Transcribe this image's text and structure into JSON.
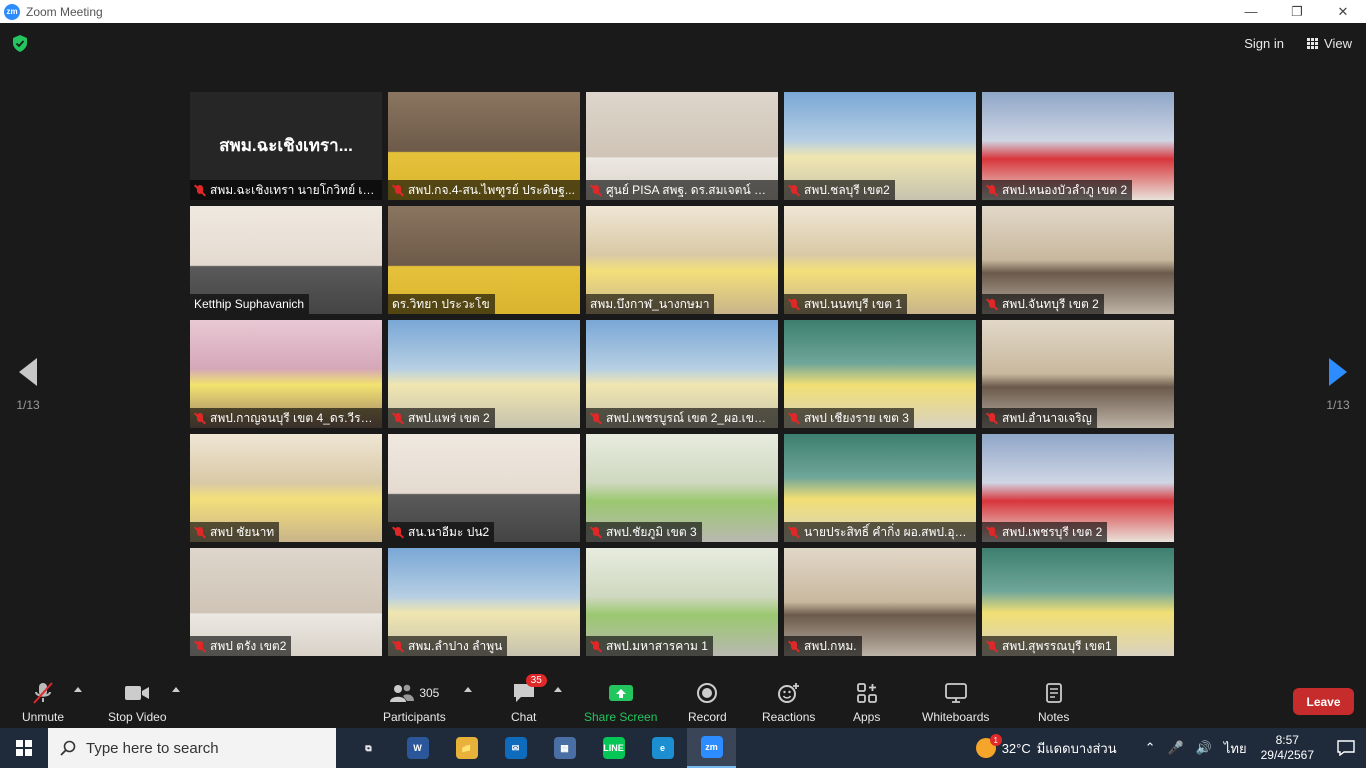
{
  "window": {
    "logo": "zm",
    "title": "Zoom Meeting",
    "minimize_glyph": "—",
    "maximize_glyph": "❐",
    "close_glyph": "✕"
  },
  "header": {
    "sign_in": "Sign in",
    "view": "View"
  },
  "pagination": {
    "prev": "1/13",
    "next": "1/13"
  },
  "tiles": [
    {
      "name": "สพม.ฉะเชิงเทรา  นายโกวิทย์ เสือ...",
      "overlay_name": "สพม.ฉะเชิงเทรา...",
      "scene": "dark"
    },
    {
      "name": "สพป.กจ.4-สน.ไพฑูรย์ ประดิษฐ...",
      "scene": "person-y"
    },
    {
      "name": "ศูนย์ PISA สพฐ. ดร.สมเจตน์ พันธ์พ...",
      "scene": "person-w",
      "active": true
    },
    {
      "name": "สพป.ชลบุรี เขต2",
      "scene": "room-b"
    },
    {
      "name": "สพป.หนองบัวลำภู เขต 2",
      "scene": "room-r"
    },
    {
      "name": "Ketthip Suphavanich",
      "scene": "person-h",
      "no_mic": true
    },
    {
      "name": "ดร.วิทยา ประวะโข",
      "scene": "person-y",
      "no_mic": true
    },
    {
      "name": "สพม.บึงกาฬ_นางกษมา",
      "scene": "room-y",
      "no_mic": true
    },
    {
      "name": "สพป.นนทบุรี เขต 1",
      "scene": "room-y"
    },
    {
      "name": "สพป.จันทบุรี เขต 2",
      "scene": "room-c"
    },
    {
      "name": "สพป.กาญจนบุรี เขต 4_ดร.วีรจ...",
      "scene": "room-p"
    },
    {
      "name": "สพป.แพร่ เขต 2",
      "scene": "room-b"
    },
    {
      "name": "สพป.เพชรบูรณ์ เขต 2_ผอ.เขต_...",
      "scene": "room-b"
    },
    {
      "name": "สพป เชียงราย เขต 3",
      "scene": "room-t"
    },
    {
      "name": "สพป.อำนาจเจริญ",
      "scene": "room-c"
    },
    {
      "name": "สพป ชัยนาท",
      "scene": "room-y"
    },
    {
      "name": "สน.นาอีมะ ปน2",
      "scene": "person-h"
    },
    {
      "name": "สพป.ชัยภูมิ เขต 3",
      "scene": "room-g"
    },
    {
      "name": "นายประสิทธิ์ คำกิ่ง ผอ.สพป.อุดร...",
      "scene": "room-t"
    },
    {
      "name": "สพป.เพชรบุรี เขต 2",
      "scene": "room-r"
    },
    {
      "name": "สพป ตรัง เขต2",
      "scene": "person-w"
    },
    {
      "name": "สพม.ลำปาง ลำพูน",
      "scene": "room-b"
    },
    {
      "name": "สพป.มหาสารคาม 1",
      "scene": "room-g"
    },
    {
      "name": "สพป.กหม.",
      "scene": "room-c"
    },
    {
      "name": "สพป.สุพรรณบุรี เขต1",
      "scene": "room-t"
    }
  ],
  "toolbar": {
    "unmute": "Unmute",
    "stop_video": "Stop Video",
    "participants": "Participants",
    "participants_count": "305",
    "chat": "Chat",
    "chat_badge": "35",
    "share_screen": "Share Screen",
    "record": "Record",
    "reactions": "Reactions",
    "apps": "Apps",
    "whiteboards": "Whiteboards",
    "notes": "Notes",
    "leave": "Leave"
  },
  "taskbar": {
    "search_placeholder": "Type here to search",
    "weather_badge": "1",
    "temperature": "32°C",
    "weather_desc": "มีแดดบางส่วน",
    "language": "ไทย",
    "time": "8:57",
    "date": "29/4/2567",
    "apps": [
      {
        "icon": "task-view-icon",
        "label": "⧉",
        "color": "transparent"
      },
      {
        "icon": "word-icon",
        "label": "W",
        "color": "#2b579a"
      },
      {
        "icon": "file-explorer-icon",
        "label": "📁",
        "color": "#e8b23a"
      },
      {
        "icon": "mail-icon",
        "label": "✉",
        "color": "#0f6cbd"
      },
      {
        "icon": "store-icon",
        "label": "▦",
        "color": "#4a6fa5"
      },
      {
        "icon": "line-icon",
        "label": "LINE",
        "color": "#06c755"
      },
      {
        "icon": "edge-icon",
        "label": "e",
        "color": "#1b8fd1"
      },
      {
        "icon": "zoom-icon",
        "label": "zm",
        "color": "#2d8cff"
      }
    ]
  },
  "colors": {
    "accent": "#2d8cff",
    "leave": "#c72c2c",
    "share": "#22c55e",
    "active_border": "#c9e85a",
    "mute": "#e02828"
  }
}
